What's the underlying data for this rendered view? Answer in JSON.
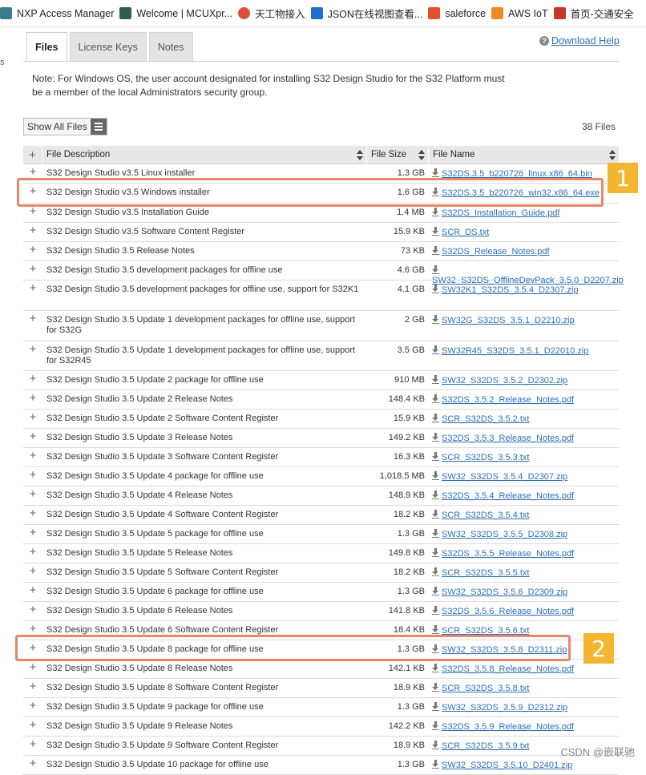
{
  "bookmarks": [
    {
      "label": "NXP Access Manager",
      "color": "#3b7b8a",
      "icon": "nxp-icon"
    },
    {
      "label": "Welcome | MCUXpr...",
      "color": "#2f5d4f",
      "icon": "x-icon"
    },
    {
      "label": "天工物接入",
      "color": "#e04e3b",
      "icon": "tiangong-icon"
    },
    {
      "label": "JSON在线视图查看...",
      "color": "#1e6fd0",
      "icon": "json-icon"
    },
    {
      "label": "saleforce",
      "color": "#e34f26",
      "icon": "windows-grid-icon"
    },
    {
      "label": "AWS IoT",
      "color": "#f08a24",
      "icon": "aws-cube-icon"
    },
    {
      "label": "首页-交通安全",
      "color": "#c0392b",
      "icon": "badge-icon"
    }
  ],
  "tabs": [
    {
      "label": "Files",
      "active": true
    },
    {
      "label": "License Keys",
      "active": false
    },
    {
      "label": "Notes",
      "active": false
    }
  ],
  "help": {
    "label": "Download Help"
  },
  "left_edge": "s",
  "note": "Note: For Windows OS, the user account designated for installing S32 Design Studio for the S32 Platform must be a member of the local Administrators security group.",
  "toolbar": {
    "show_all": "Show All Files",
    "count": "38 Files"
  },
  "table": {
    "headers": {
      "description": "File Description",
      "size": "File Size",
      "name": "File Name"
    },
    "rows": [
      {
        "desc": "S32 Design Studio v3.5 Linux installer",
        "size": "1.3 GB",
        "file": "S32DS.3.5_b220726_linux.x86_64.bin"
      },
      {
        "desc": "S32 Design Studio v3.5 Windows installer",
        "size": "1.6 GB",
        "file": "S32DS.3.5_b220726_win32.x86_64.exe"
      },
      {
        "desc": "S32 Design Studio v3.5 Installation Guide",
        "size": "1.4 MB",
        "file": "S32DS_Installation_Guide.pdf"
      },
      {
        "desc": "S32 Design Studio v3.5 Software Content Register",
        "size": "15.9 KB",
        "file": "SCR_DS.txt"
      },
      {
        "desc": "S32 Design Studio 3.5 Release Notes",
        "size": "73 KB",
        "file": "S32DS_Release_Notes.pdf"
      },
      {
        "desc": "S32 Design Studio 3.5 development packages for offline use",
        "size": "4.6 GB",
        "file": "SW32_S32DS_OfflineDevPack_3.5.0_D2207.zip"
      },
      {
        "desc": "S32 Design Studio 3.5 development packages for offline use, support for S32K1",
        "size": "4.1 GB",
        "file": "SW32K1_S32DS_3.5.4_D2307.zip"
      },
      {
        "desc": "S32 Design Studio 3.5 Update 1 development packages for offline use, support for S32G",
        "size": "2 GB",
        "file": "SW32G_S32DS_3.5.1_D2210.zip"
      },
      {
        "desc": "S32 Design Studio 3.5 Update 1 development packages for offline use, support for S32R45",
        "size": "3.5 GB",
        "file": "SW32R45_S32DS_3.5.1_D22010.zip"
      },
      {
        "desc": "S32 Design Studio 3.5 Update 2 package for offline use",
        "size": "910 MB",
        "file": "SW32_S32DS_3.5.2_D2302.zip"
      },
      {
        "desc": "S32 Design Studio 3.5 Update 2 Release Notes",
        "size": "148.4 KB",
        "file": "S32DS_3.5.2_Release_Notes.pdf"
      },
      {
        "desc": "S32 Design Studio 3.5 Update 2 Software Content Register",
        "size": "15.9 KB",
        "file": "SCR_S32DS_3.5.2.txt"
      },
      {
        "desc": "S32 Design Studio 3.5 Update 3 Release Notes",
        "size": "149.2 KB",
        "file": "S32DS_3.5.3_Release_Notes.pdf"
      },
      {
        "desc": "S32 Design Studio 3.5 Update 3 Software Content Register",
        "size": "16.3 KB",
        "file": "SCR_S32DS_3.5.3.txt"
      },
      {
        "desc": "S32 Design Studio 3.5 Update 4 package for offline use",
        "size": "1,018.5 MB",
        "file": "SW32_S32DS_3.5.4_D2307.zip"
      },
      {
        "desc": "S32 Design Studio 3.5 Update 4 Release Notes",
        "size": "148.9 KB",
        "file": "S32DS_3.5.4_Release_Notes.pdf"
      },
      {
        "desc": "S32 Design Studio 3.5 Update 4 Software Content Register",
        "size": "18.2 KB",
        "file": "SCR_S32DS_3.5.4.txt"
      },
      {
        "desc": "S32 Design Studio 3.5 Update 5 package for offline use",
        "size": "1.3 GB",
        "file": "SW32_S32DS_3.5.5_D2308.zip"
      },
      {
        "desc": "S32 Design Studio 3.5 Update 5 Release Notes",
        "size": "149.8 KB",
        "file": "S32DS_3.5.5_Release_Notes.pdf"
      },
      {
        "desc": "S32 Design Studio 3.5 Update 5 Software Content Register",
        "size": "18.2 KB",
        "file": "SCR_S32DS_3.5.5.txt"
      },
      {
        "desc": "S32 Design Studio 3.5 Update 6 package for offline use",
        "size": "1.3 GB",
        "file": "SW32_S32DS_3.5.6_D2309.zip"
      },
      {
        "desc": "S32 Design Studio 3.5 Update 6 Release Notes",
        "size": "141.8 KB",
        "file": "S32DS_3.5.6_Release_Notes.pdf"
      },
      {
        "desc": "S32 Design Studio 3.5 Update 6 Software Content Register",
        "size": "18.4 KB",
        "file": "SCR_S32DS_3.5.6.txt"
      },
      {
        "desc": "S32 Design Studio 3.5 Update 8 package for offline use",
        "size": "1.3 GB",
        "file": "SW32_S32DS_3.5.8_D2311.zip"
      },
      {
        "desc": "S32 Design Studio 3.5 Update 8 Release Notes",
        "size": "142.1 KB",
        "file": "S32DS_3.5.8_Release_Notes.pdf"
      },
      {
        "desc": "S32 Design Studio 3.5 Update 8 Software Content Register",
        "size": "18.9 KB",
        "file": "SCR_S32DS_3.5.8.txt"
      },
      {
        "desc": "S32 Design Studio 3.5 Update 9 package for offline use",
        "size": "1.3 GB",
        "file": "SW32_S32DS_3.5.9_D2312.zip"
      },
      {
        "desc": "S32 Design Studio 3.5 Update 9 Release Notes",
        "size": "142.2 KB",
        "file": "S32DS_3.5.9_Release_Notes.pdf"
      },
      {
        "desc": "S32 Design Studio 3.5 Update 9 Software Content Register",
        "size": "18.9 KB",
        "file": "SCR_S32DS_3.5.9.txt"
      },
      {
        "desc": "S32 Design Studio 3.5 Update 10 package for offline use",
        "size": "1.3 GB",
        "file": "SW32_S32DS_3.5.10_D2401.zip"
      }
    ]
  },
  "annotations": {
    "badge1": "1",
    "badge2": "2",
    "highlight_color": "#e9866b",
    "badge_color": "#f2b631"
  },
  "watermark": "CSDN @嵌联驰"
}
